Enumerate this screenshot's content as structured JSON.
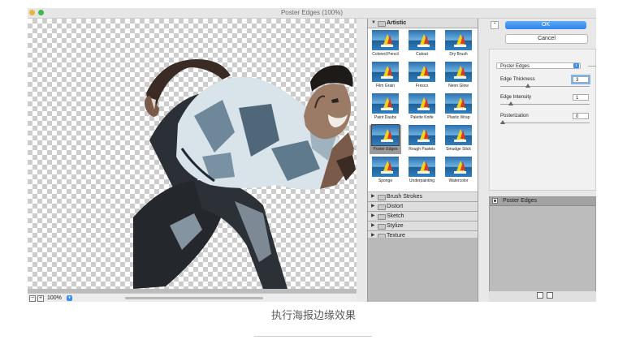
{
  "window": {
    "title": "Poster Edges (100%)"
  },
  "canvas": {
    "zoom": "100%"
  },
  "filter_gallery": {
    "artistic": {
      "label": "Artistic",
      "expanded": true,
      "filters": [
        "Colored Pencil",
        "Cutout",
        "Dry Brush",
        "Film Grain",
        "Fresco",
        "Neon Glow",
        "Paint Daubs",
        "Palette Knife",
        "Plastic Wrap",
        "Poster Edges",
        "Rough Pastels",
        "Smudge Stick",
        "Sponge",
        "Underpainting",
        "Watercolor"
      ],
      "selected": "Poster Edges"
    },
    "categories": [
      "Brush Strokes",
      "Distort",
      "Sketch",
      "Stylize",
      "Texture"
    ]
  },
  "settings": {
    "ok_label": "OK",
    "cancel_label": "Cancel",
    "filter_select": "Poster Edges",
    "params": [
      {
        "label": "Edge Thickness",
        "value": "3",
        "level": 0.3
      },
      {
        "label": "Edge Intensity",
        "value": "1",
        "level": 0.1
      },
      {
        "label": "Posterization",
        "value": "0",
        "level": 0.0
      }
    ]
  },
  "effects": {
    "layer_label": "Poster Edges"
  },
  "caption": "执行海报边缘效果",
  "icons": {
    "minimize": "minimize-dot-icon",
    "maximize": "maximize-dot-icon",
    "collapse": "collapse-arrow-icon",
    "eye": "eye-icon",
    "folder": "folder-icon",
    "new_layer": "new-effect-layer-icon",
    "trash": "trash-icon"
  },
  "colors": {
    "accent": "#3a8ef0",
    "panel": "#e8e8e8",
    "gallery_bg": "#bdbdbd"
  }
}
